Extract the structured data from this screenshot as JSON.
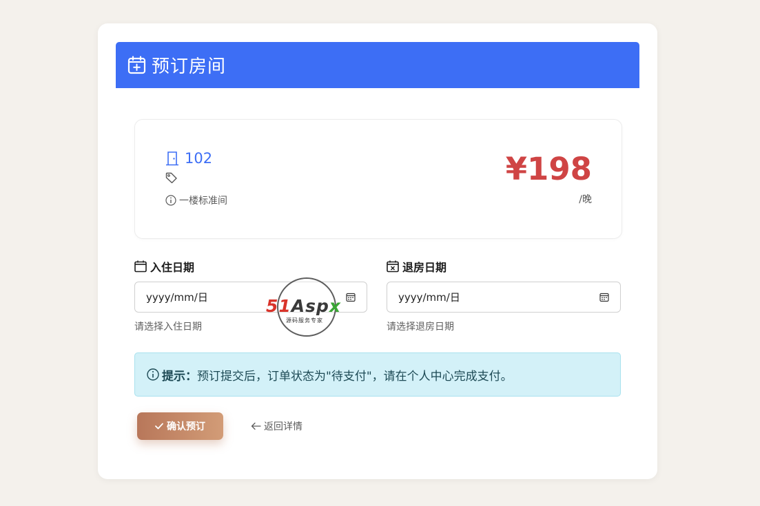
{
  "header": {
    "title": "预订房间",
    "icon": "calendar-plus-icon",
    "color": "#3d6ef5"
  },
  "room": {
    "number": "102",
    "description": "一楼标准间",
    "price": "¥198",
    "price_unit": "/晚",
    "price_color": "#cf4444"
  },
  "form": {
    "checkin": {
      "label": "入住日期",
      "value": "yyyy/mm/日",
      "help": "请选择入住日期"
    },
    "checkout": {
      "label": "退房日期",
      "value": "yyyy/mm/日",
      "help": "请选择退房日期"
    }
  },
  "notice": {
    "label": "提示：",
    "text": "预订提交后，订单状态为\"待支付\"，请在个人中心完成支付。"
  },
  "actions": {
    "confirm_label": "确认预订",
    "back_label": "返回详情"
  },
  "watermark": {
    "logo_part1": "51",
    "logo_part2": "Asp",
    "logo_part3": "x",
    "subtitle": "源码服务专家"
  }
}
